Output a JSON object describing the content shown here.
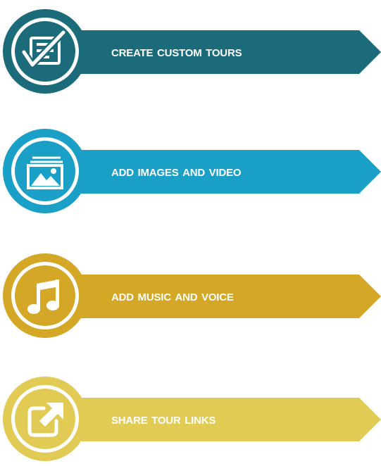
{
  "features": [
    {
      "label": "Create Custom Tours",
      "icon": "checklist-icon",
      "color": "#1b6b7b",
      "ring": "#1b6b7b"
    },
    {
      "label": "Add Images And Video",
      "icon": "image-gallery-icon",
      "color": "#1a9fc7",
      "ring": "#1a9fc7"
    },
    {
      "label": "Add Music And Voice",
      "icon": "music-note-icon",
      "color": "#d4a826",
      "ring": "#d4a826"
    },
    {
      "label": "Share Tour Links",
      "icon": "share-link-icon",
      "color": "#e2cb54",
      "ring": "#e2cb54"
    }
  ]
}
